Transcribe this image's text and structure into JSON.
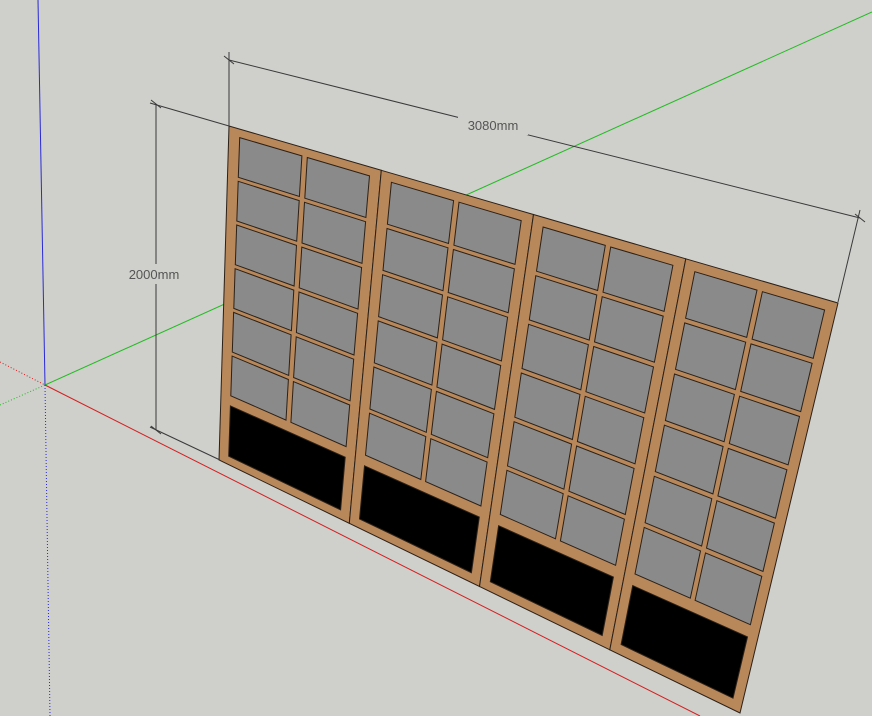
{
  "viewport": {
    "background_color": "#cfcfcb",
    "axes": {
      "blue_axis_color": "#2a2ad8",
      "green_axis_color": "#1fbd1f",
      "red_axis_color": "#d42020"
    }
  },
  "model": {
    "frame_color": "#b8875a",
    "frame_edge_color": "#2b2118",
    "glass_color": "#8a8a8a",
    "bottom_panel_color": "#000000"
  },
  "dimensions": {
    "width_label": "3080mm",
    "height_label": "2000mm",
    "line_color": "#3a3a3a"
  }
}
